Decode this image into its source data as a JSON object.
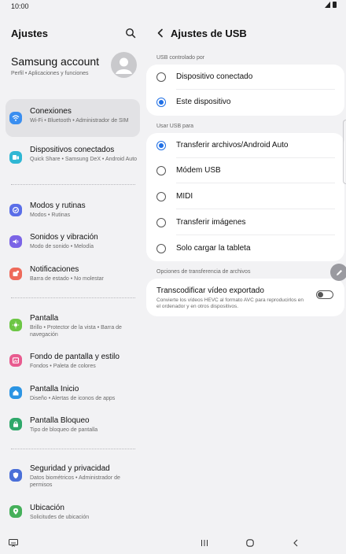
{
  "status": {
    "time": "10:00"
  },
  "left": {
    "title": "Ajustes",
    "account": {
      "name": "Samsung account",
      "sub": "Perfil • Aplicaciones y funciones"
    },
    "items": [
      {
        "title": "Conexiones",
        "sub": "Wi-Fi • Bluetooth • Administrador de SIM",
        "icon": "wifi-icon",
        "color": "#3a8ef0"
      },
      {
        "title": "Dispositivos conectados",
        "sub": "Quick Share • Samsung DeX • Android Auto",
        "icon": "devices-icon",
        "color": "#2fb7d4"
      },
      {
        "title": "Modos y rutinas",
        "sub": "Modos • Rutinas",
        "icon": "modes-icon",
        "color": "#5a6ee8"
      },
      {
        "title": "Sonidos y vibración",
        "sub": "Modo de sonido • Melodía",
        "icon": "sound-icon",
        "color": "#7b64e6"
      },
      {
        "title": "Notificaciones",
        "sub": "Barra de estado • No molestar",
        "icon": "notification-icon",
        "color": "#ee6a5a"
      },
      {
        "title": "Pantalla",
        "sub": "Brillo • Protector de la vista • Barra de navegación",
        "icon": "brightness-icon",
        "color": "#6cc644"
      },
      {
        "title": "Fondo de pantalla y estilo",
        "sub": "Fondos • Paleta de colores",
        "icon": "wallpaper-icon",
        "color": "#e85b8f"
      },
      {
        "title": "Pantalla Inicio",
        "sub": "Diseño • Alertas de iconos de apps",
        "icon": "home-icon",
        "color": "#2b94e3"
      },
      {
        "title": "Pantalla Bloqueo",
        "sub": "Tipo de bloqueo de pantalla",
        "icon": "lock-icon",
        "color": "#2fa86a"
      },
      {
        "title": "Seguridad y privacidad",
        "sub": "Datos biométricos • Administrador de permisos",
        "icon": "shield-icon",
        "color": "#4a6fd8"
      },
      {
        "title": "Ubicación",
        "sub": "Solicitudes de ubicación",
        "icon": "location-icon",
        "color": "#45b05a"
      }
    ]
  },
  "right": {
    "title": "Ajustes de USB",
    "section1": "USB controlado por",
    "controlled": [
      {
        "label": "Dispositivo conectado",
        "checked": false
      },
      {
        "label": "Este dispositivo",
        "checked": true
      }
    ],
    "section2": "Usar USB para",
    "usage": [
      {
        "label": "Transferir archivos/Android Auto",
        "checked": true
      },
      {
        "label": "Módem USB",
        "checked": false
      },
      {
        "label": "MIDI",
        "checked": false
      },
      {
        "label": "Transferir imágenes",
        "checked": false
      },
      {
        "label": "Solo cargar la tableta",
        "checked": false
      }
    ],
    "section3": "Opciones de transferencia de archivos",
    "transcode": {
      "title": "Transcodificar vídeo exportado",
      "sub": "Convierte los vídeos HEVC al formato AVC para reproducirlos en el ordenador y en otros dispositivos.",
      "enabled": false
    }
  },
  "colors": {
    "accent": "#1f6fe5",
    "background": "#f2f2f4",
    "card": "#ffffff"
  }
}
